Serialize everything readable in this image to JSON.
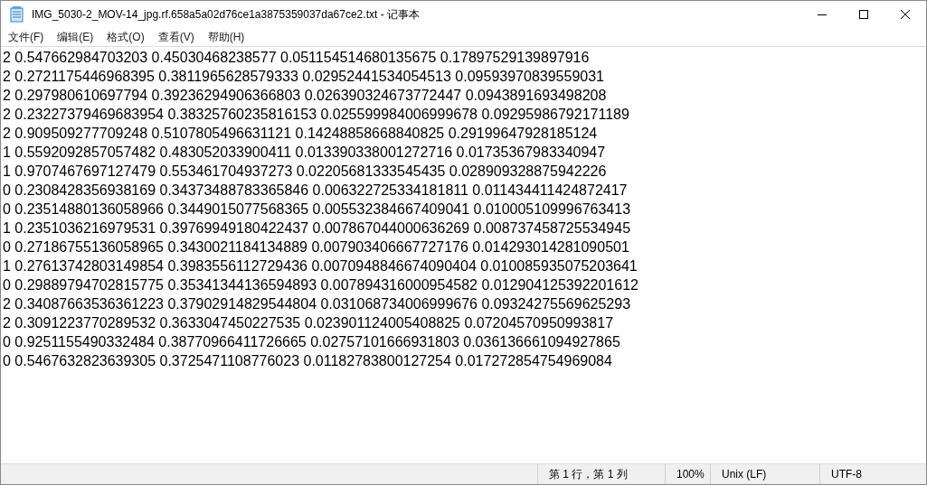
{
  "window": {
    "title": "IMG_5030-2_MOV-14_jpg.rf.658a5a02d76ce1a3875359037da67ce2.txt - 记事本"
  },
  "menu": [
    "文件(F)",
    "编辑(E)",
    "格式(O)",
    "查看(V)",
    "帮助(H)"
  ],
  "lines": [
    "2 0.547662984703203 0.45030468238577 0.051154514680135675 0.17897529139897916",
    "2 0.2721175446968395 0.3811965628579333 0.02952441534054513 0.09593970839559031",
    "2 0.297980610697794 0.39236294906366803 0.026390324673772447 0.0943891693498208",
    "2 0.23227379469683954 0.38325760235816153 0.025599984006999678 0.09295986792171189",
    "2 0.909509277709248 0.5107805496631121 0.14248858668840825 0.29199647928185124",
    "1 0.5592092857057482 0.483052033900411 0.013390338001272716 0.01735367983340947",
    "1 0.9707467697127479 0.553461704937273 0.02205681333545435 0.028909328875942226",
    "0 0.2308428356938169 0.34373488783365846 0.006322725334181811 0.011434411424872417",
    "0 0.23514880136058966 0.3449015077568365 0.005532384667409041 0.010005109996763413",
    "1 0.2351036216979531 0.39769949180422437 0.007867044000636269 0.008737458725534945",
    "0 0.27186755136058965 0.3430021184134889 0.007903406667727176 0.014293014281090501",
    "1 0.27613742803149854 0.3983556112729436 0.0070948846674090404 0.010085935075203641",
    "0 0.29889794702815775 0.35341344136594893 0.007894316000954582 0.012904125392201612",
    "2 0.34087663536361223 0.37902914829544804 0.031068734006999676 0.09324275569625293",
    "2 0.3091223770289532 0.3633047450227535 0.023901124005408825 0.07204570950993817",
    "0 0.9251155490332484 0.38770966411726665 0.02757101666931803 0.036136661094927865",
    "0 0.5467632823639305 0.3725471108776023 0.01182783800127254 0.017272854754969084"
  ],
  "status_bar": {
    "position": "第 1 行，第 1 列",
    "zoom": "100%",
    "line_ending": "Unix (LF)",
    "encoding": "UTF-8"
  }
}
